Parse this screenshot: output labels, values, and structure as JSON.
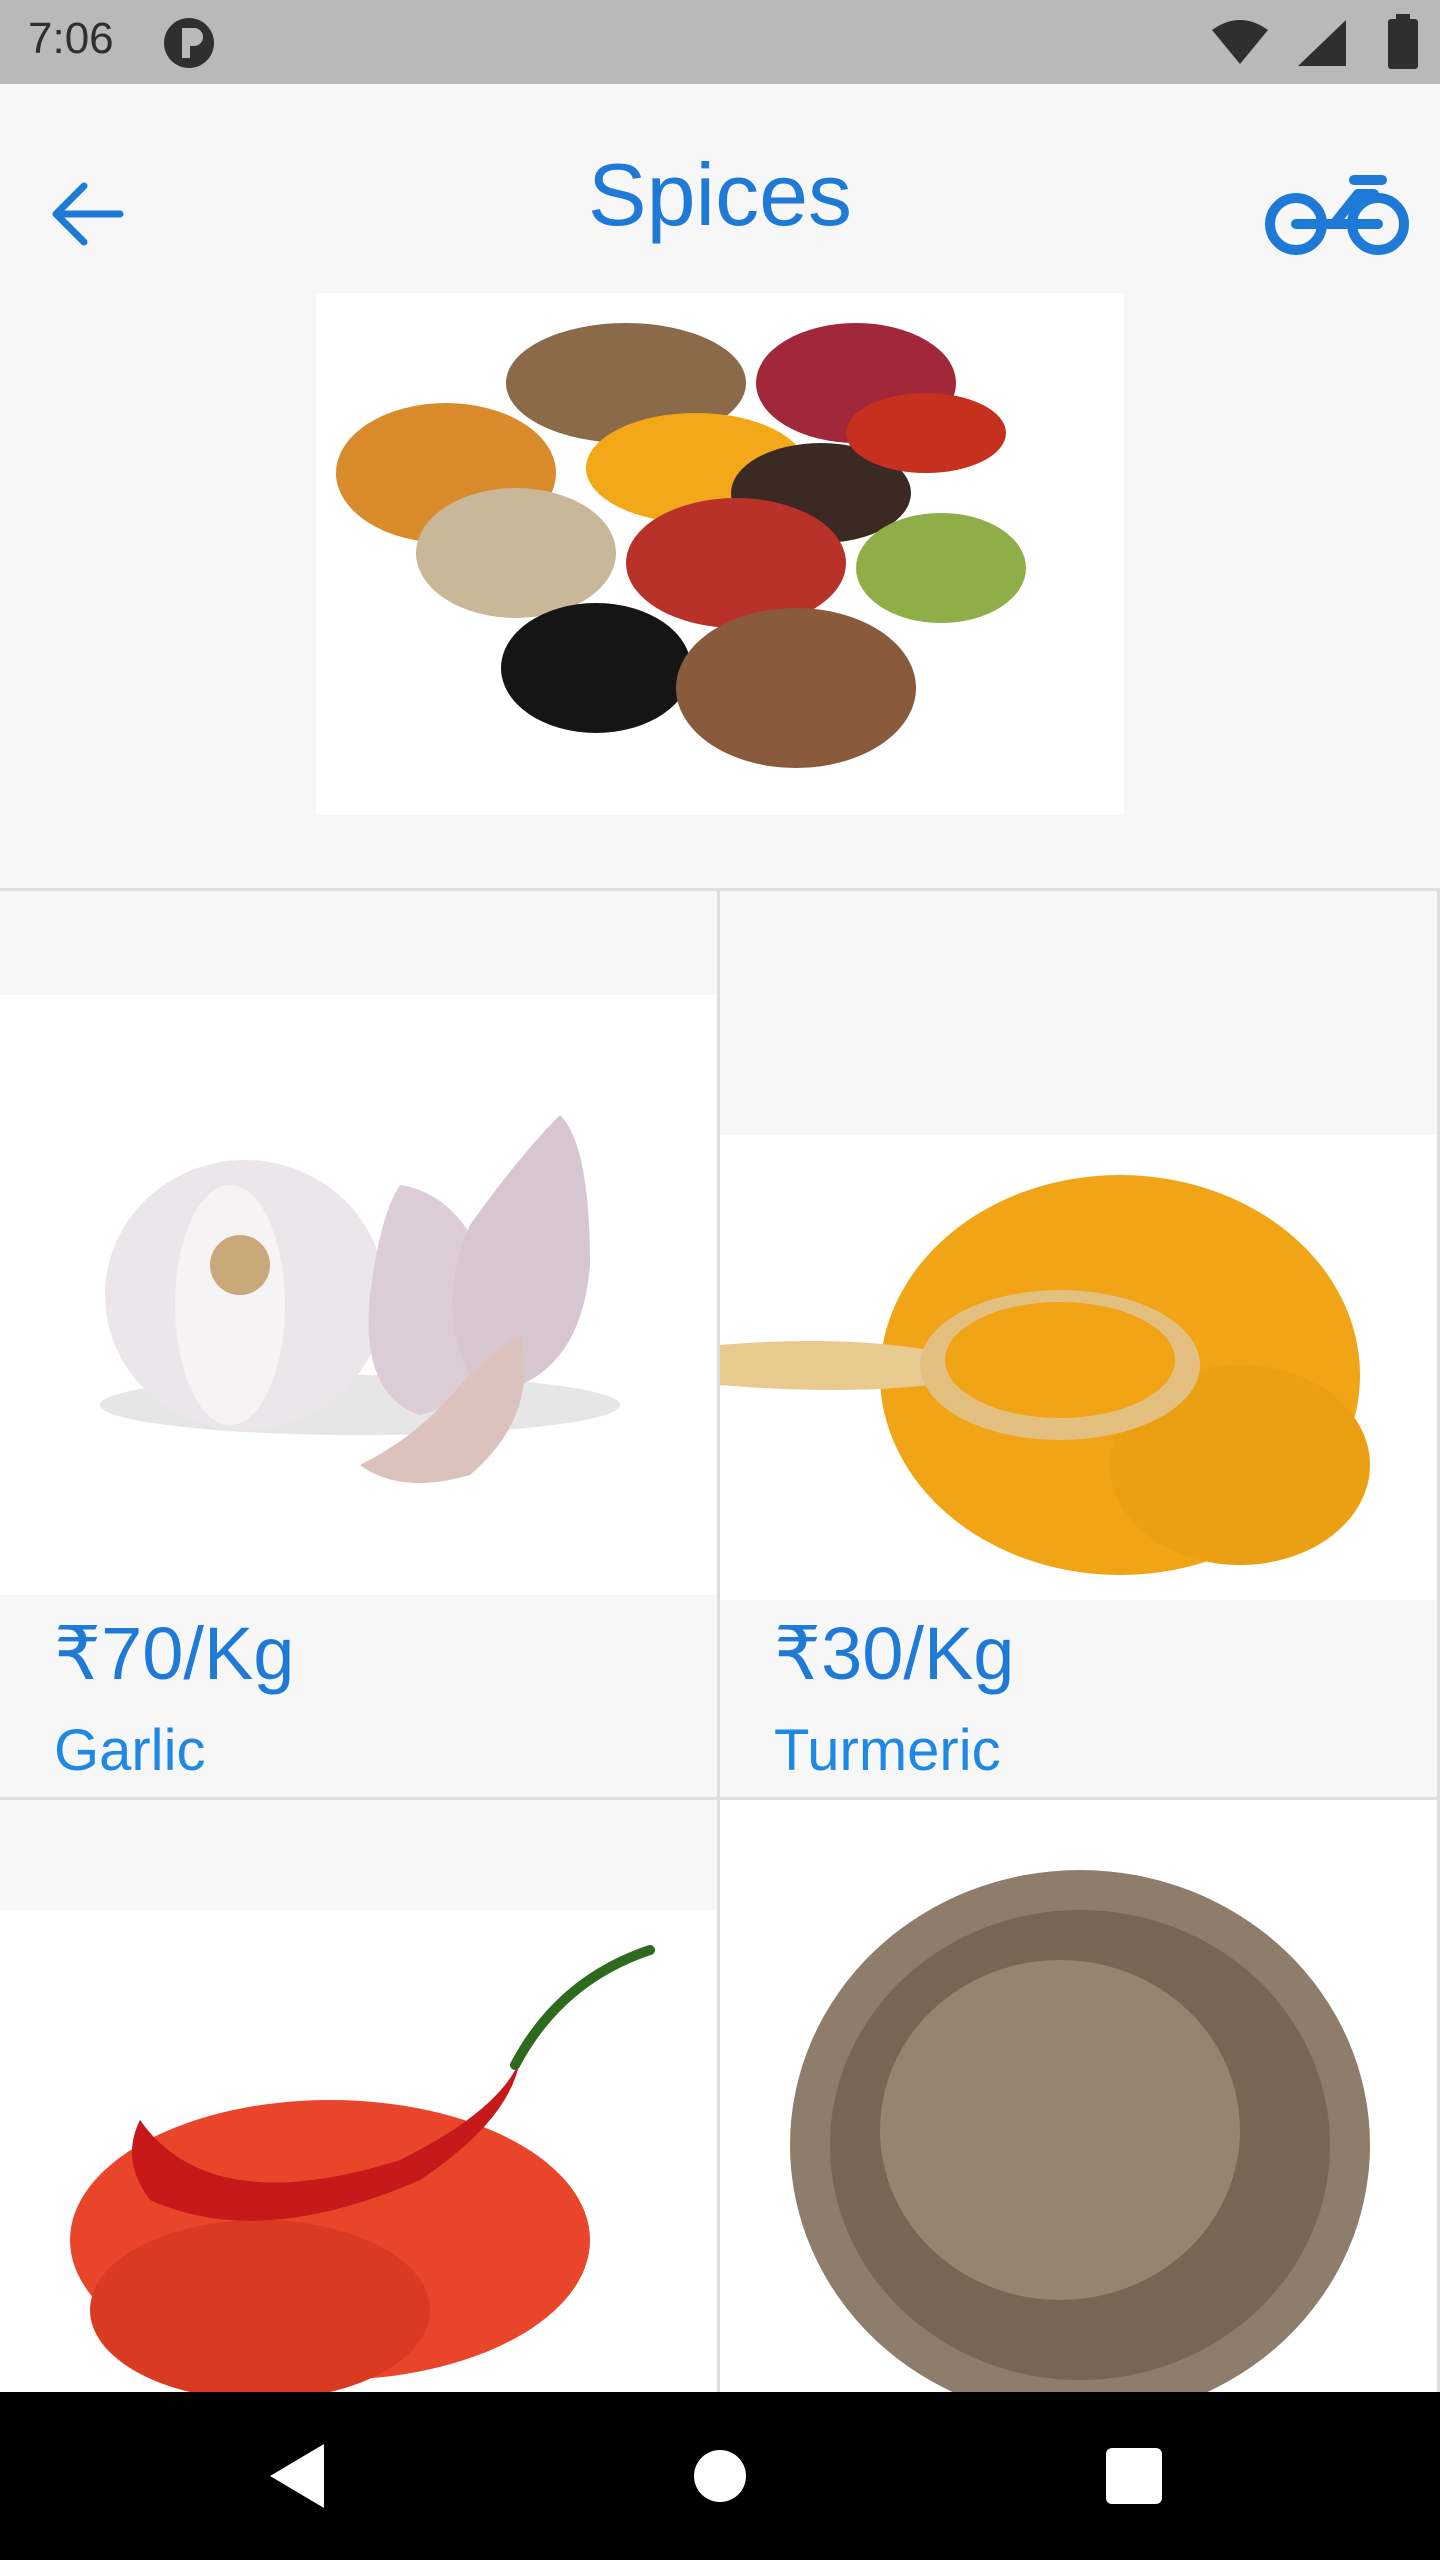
{
  "status": {
    "time": "7:06"
  },
  "header": {
    "title": "Spices"
  },
  "products": [
    {
      "price": "₹70/Kg",
      "name": "Garlic"
    },
    {
      "price": "₹30/Kg",
      "name": "Turmeric"
    },
    {
      "price": "",
      "name": ""
    },
    {
      "price": "",
      "name": ""
    }
  ],
  "colors": {
    "accent": "#1e7ad6",
    "status_bar": "#b9b9b9",
    "background": "#f7f7f7"
  },
  "icons": [
    "back-arrow-icon",
    "bike-icon",
    "wifi-icon",
    "signal-icon",
    "battery-icon",
    "nav-back-icon",
    "nav-home-icon",
    "nav-recents-icon"
  ]
}
